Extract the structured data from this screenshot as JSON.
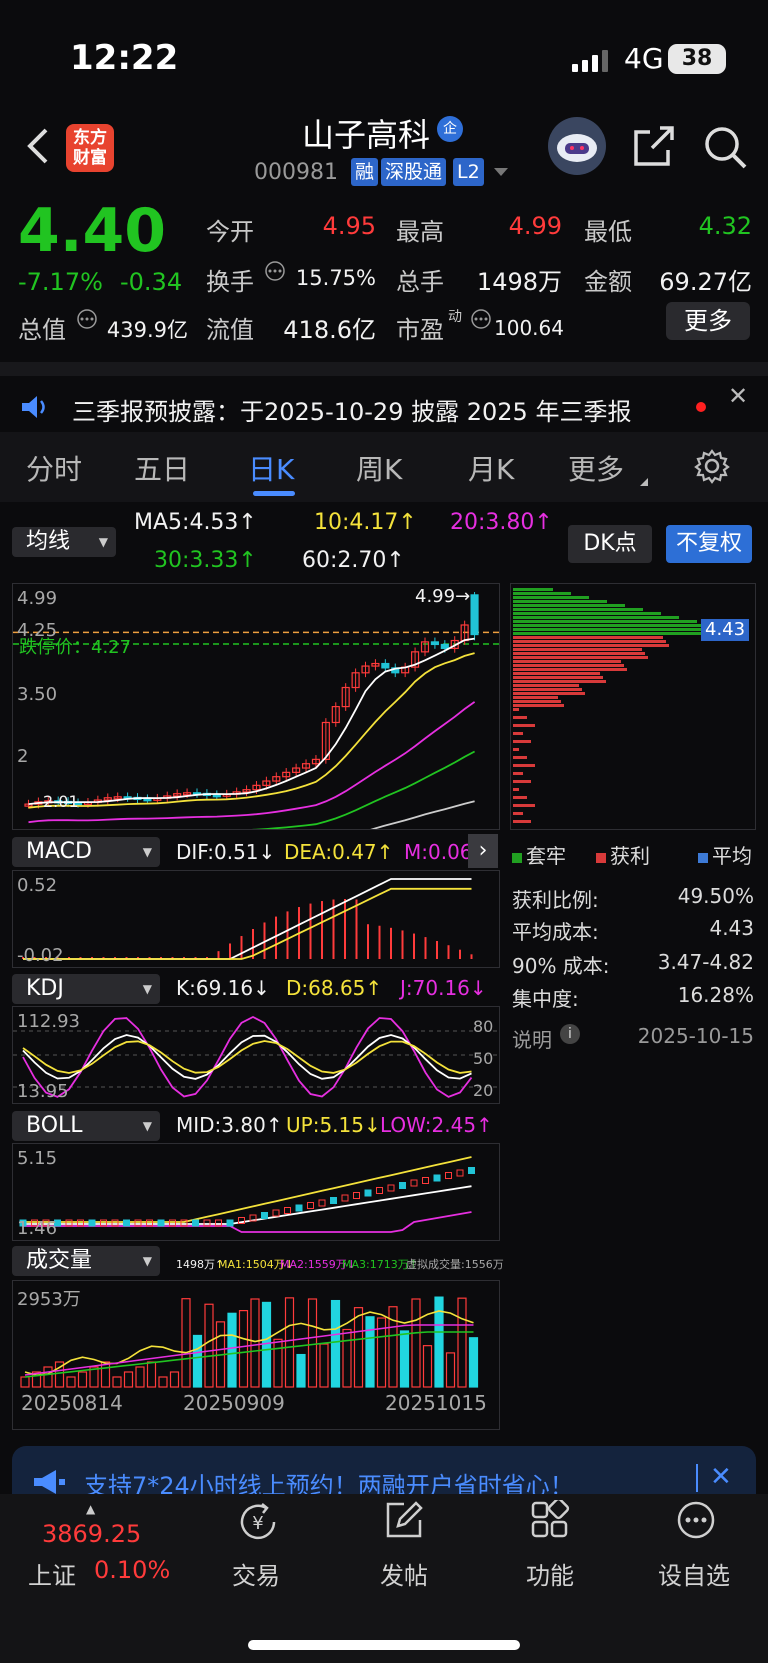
{
  "status_bar": {
    "time": "12:22",
    "network": "4G",
    "battery": "38"
  },
  "header": {
    "logo_text": "东方财富",
    "stock_name": "山子高科",
    "badge": "企",
    "stock_code": "000981",
    "tags": [
      "融",
      "深股通",
      "L2"
    ]
  },
  "quote": {
    "price": "4.40",
    "change_pct": "-7.17%",
    "change": "-0.34",
    "fields": {
      "open_label": "今开",
      "open": "4.95",
      "high_label": "最高",
      "high": "4.99",
      "low_label": "最低",
      "low": "4.32",
      "turnover_label": "换手",
      "turnover": "15.75%",
      "volume_label": "总手",
      "volume": "1498万",
      "amount_label": "金额",
      "amount": "69.27亿",
      "mktcap_label": "总值",
      "mktcap": "439.9亿",
      "float_label": "流值",
      "float": "418.6亿",
      "pe_label": "市盈",
      "pe_sup": "动",
      "pe": "100.64"
    },
    "more_button": "更多"
  },
  "notice": {
    "text": "三季报预披露：于2025-10-29 披露 2025 年三季报"
  },
  "tabs": [
    "分时",
    "五日",
    "日K",
    "周K",
    "月K",
    "更多"
  ],
  "active_tab": "日K",
  "ma_bar": {
    "selector": "均线",
    "ma5": "MA5:4.53↑",
    "ma10": "10:4.17↑",
    "ma20": "20:3.80↑",
    "ma30": "30:3.33↑",
    "ma60": "60:2.70↑",
    "dk_button": "DK点",
    "fq_button": "不复权"
  },
  "kline": {
    "y_top": "4.99",
    "y_mid1": "4.25",
    "y_mid2": "3.50",
    "y_mid3": "2",
    "y_low": "2.01",
    "limit_down": "跌停价：4.27",
    "max_label": "4.99→",
    "chip_price": "4.43",
    "watermark": "东方财富"
  },
  "chart_data": {
    "type": "candlestick",
    "dates_shown": [
      "20250814",
      "20250909",
      "20251015"
    ],
    "last_close": 4.4,
    "last_high": 4.99,
    "last_low": 4.32,
    "last_open": 4.95,
    "ylim": [
      2.01,
      4.99
    ],
    "indicators": {
      "MACD": {
        "DIF": 0.51,
        "DEA": 0.47,
        "M": 0.06,
        "ymax": 0.52,
        "ymin": -0.02
      },
      "KDJ": {
        "K": 69.16,
        "D": 68.65,
        "J": 70.16,
        "ymax": 112.93,
        "ymin": 13.95,
        "levels": [
          80,
          50,
          20
        ]
      },
      "BOLL": {
        "MID": 3.8,
        "UP": 5.15,
        "LOW": 2.45,
        "ymax": 5.15,
        "ymin": 1.46
      },
      "VOL": {
        "vol": "1498万",
        "MA1": "1504万",
        "MA2": "1559万",
        "MA3": "1713万",
        "virtual": "1556万",
        "ymax": "2953万"
      }
    }
  },
  "macd_bar": {
    "selector": "MACD",
    "dif": "DIF:0.51↓",
    "dea": "DEA:0.47↑",
    "m": "M:0.06",
    "top": "0.52",
    "bottom": "-0.02"
  },
  "kdj_bar": {
    "selector": "KDJ",
    "k": "K:69.16↓",
    "d": "D:68.65↑",
    "j": "J:70.16↓",
    "top": "112.93",
    "bottom": "13.95",
    "l80": "80",
    "l50": "50",
    "l20": "20"
  },
  "boll_bar": {
    "selector": "BOLL",
    "mid": "MID:3.80↑",
    "up": "UP:5.15↓",
    "low": "LOW:2.45↑",
    "top": "5.15",
    "bottom": "1.46"
  },
  "vol_bar": {
    "selector": "成交量",
    "v": "1498万↑",
    "ma1": "MA1:1504万↓",
    "ma2": "MA2:1559万↓",
    "ma3": "MA3:1713万↑",
    "virt": "虚拟成交量:1556万",
    "top": "2953万"
  },
  "x_dates": [
    "20250814",
    "20250909",
    "20251015"
  ],
  "chips": {
    "legend": [
      "套牢",
      "获利",
      "平均"
    ],
    "stats": [
      {
        "label": "获利比例:",
        "value": "49.50%"
      },
      {
        "label": "平均成本:",
        "value": "4.43"
      },
      {
        "label": "90% 成本:",
        "value": "3.47-4.82"
      },
      {
        "label": "集中度:",
        "value": "16.28%"
      }
    ],
    "note_label": "说明",
    "date": "2025-10-15"
  },
  "promo": {
    "text": "支持7*24小时线上预约！两融开户省时省心！"
  },
  "bottom_nav": {
    "index_value": "3869.25",
    "index_name": "上证",
    "index_pct": "0.10%",
    "items": [
      "交易",
      "发帖",
      "功能",
      "设自选"
    ]
  },
  "colors": {
    "up": "#ff3b3b",
    "down": "#21c421",
    "accent": "#4a8cff"
  }
}
